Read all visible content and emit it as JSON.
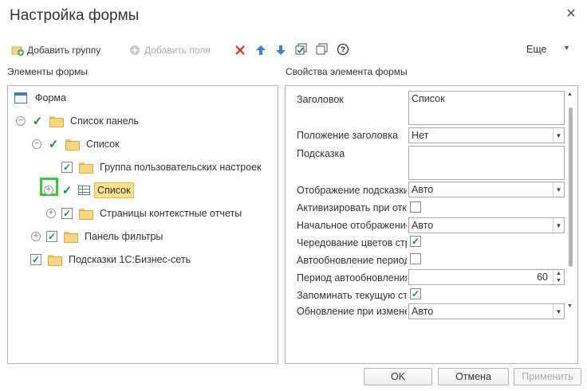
{
  "window": {
    "title": "Настройка формы"
  },
  "toolbar": {
    "add_group": "Добавить группу",
    "add_fields": "Добавить поля",
    "more": "Еще"
  },
  "sections": {
    "left": "Элементы формы",
    "right": "Свойства элемента формы"
  },
  "tree": {
    "root": "Форма",
    "items": [
      {
        "label": "Список панель",
        "checked": true
      },
      {
        "label": "Список",
        "checked": true
      },
      {
        "label": "Группа пользовательских настроек",
        "checked": true
      },
      {
        "label": "Список",
        "checked": true,
        "selected": true
      },
      {
        "label": "Страницы контекстные отчеты",
        "checked": true
      },
      {
        "label": "Панель фильтры",
        "checked": true
      },
      {
        "label": "Подсказки 1С:Бизнес-сеть",
        "checked": true
      }
    ]
  },
  "properties": {
    "title_label": "Заголовок",
    "title_value": "Список",
    "title_position_label": "Положение заголовка",
    "title_position_value": "Нет",
    "tooltip_label": "Подсказка",
    "tooltip_value": "",
    "tooltip_display_label": "Отображение подсказки",
    "tooltip_display_value": "Авто",
    "activate_label": "Активизировать при открытии",
    "initial_display_label": "Начальное отображение",
    "initial_display_value": "Авто",
    "alternating_label": "Чередование цветов строк",
    "autoupdate_label": "Автообновление периодически",
    "autoupdate_period_label": "Период автообновления",
    "autoupdate_period_value": "60",
    "remember_label": "Запоминать текущую строку",
    "update_on_change_label": "Обновление при изменении",
    "update_on_change_value": "Авто"
  },
  "buttons": {
    "ok": "OK",
    "cancel": "Отмена",
    "apply": "Применить"
  },
  "colors": {
    "check": "#1a8f3a",
    "selection": "#fce08a",
    "focus": "#33cc33"
  }
}
